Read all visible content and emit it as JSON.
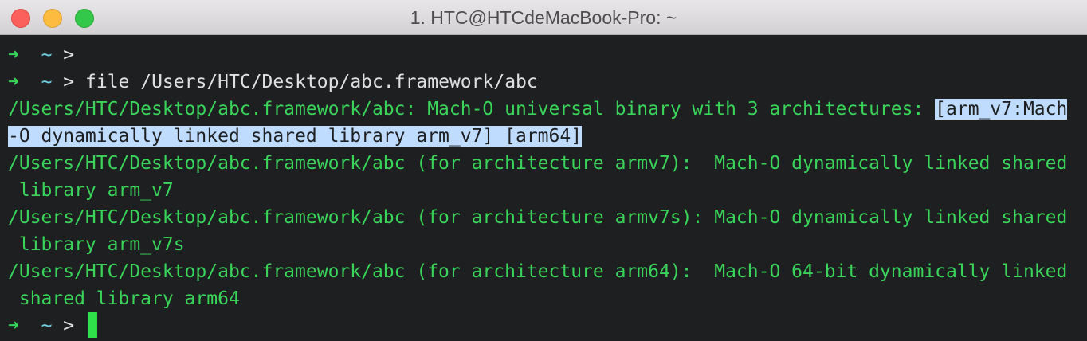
{
  "window": {
    "title": "1. HTC@HTCdeMacBook-Pro: ~"
  },
  "prompt": {
    "arrow": "➜",
    "dir": "~",
    "symbol": ">"
  },
  "command": "file /Users/HTC/Desktop/abc.framework/abc",
  "output": {
    "line1_plain": "/Users/HTC/Desktop/abc.framework/abc: Mach-O universal binary with 3 architectures: ",
    "line1_selected": "[arm_v7:Mach",
    "line2_selected": "-O dynamically linked shared library arm_v7] [arm64]",
    "line3": "/Users/HTC/Desktop/abc.framework/abc (for architecture armv7):  Mach-O dynamically linked shared",
    "line4": " library arm_v7",
    "line5": "/Users/HTC/Desktop/abc.framework/abc (for architecture armv7s): Mach-O dynamically linked shared",
    "line6": " library arm_v7s",
    "line7": "/Users/HTC/Desktop/abc.framework/abc (for architecture arm64):  Mach-O 64-bit dynamically linked",
    "line8": " shared library arm64"
  },
  "colors": {
    "background": "#1d1f21",
    "output_green": "#3ad45a",
    "tilde_cyan": "#6fd0e4",
    "selection": "#bfdcff",
    "cursor": "#2fe04a"
  }
}
